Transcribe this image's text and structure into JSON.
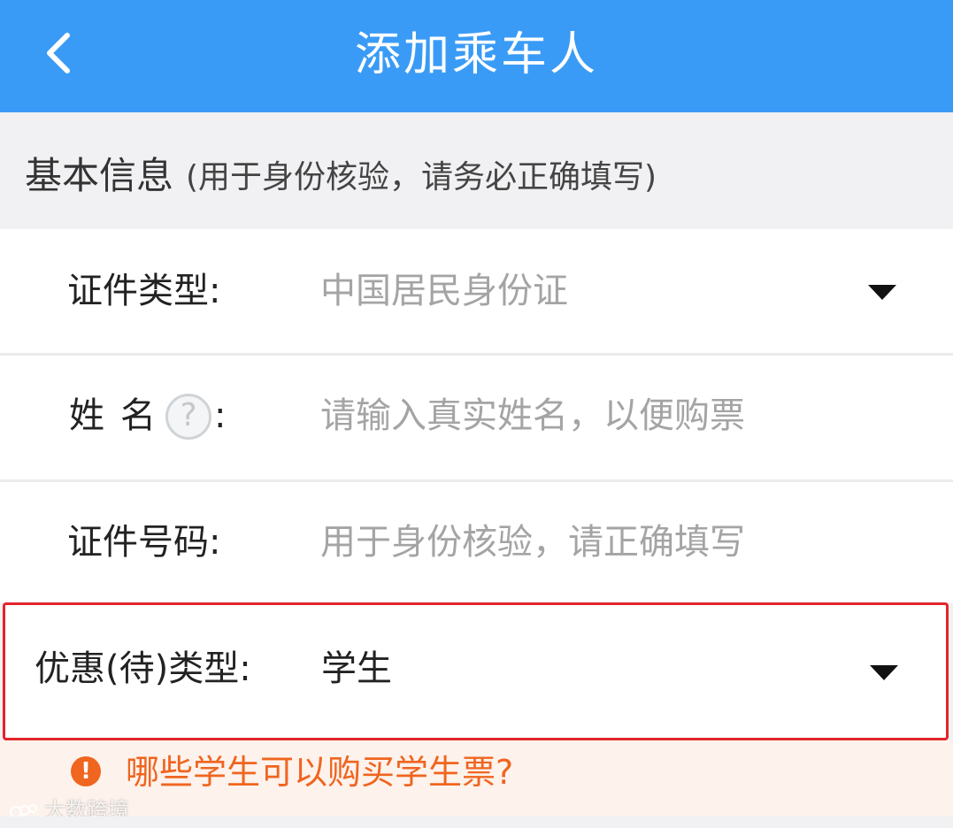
{
  "header": {
    "title": "添加乘车人",
    "back_icon": "chevron-left-icon",
    "background_color": "#3a9bf6"
  },
  "section": {
    "title": "基本信息",
    "subtitle": "(用于身份核验，请务必正确填写)"
  },
  "fields": {
    "id_type": {
      "label": "证件类型:",
      "value": "中国居民身份证",
      "icon": "caret-down-icon"
    },
    "name": {
      "label_part1": "姓",
      "label_part2": "名",
      "help_glyph": "?",
      "colon": ":",
      "placeholder": "请输入真实姓名，以便购票",
      "icon": "help-circle-icon"
    },
    "id_number": {
      "label": "证件号码:",
      "placeholder": "用于身份核验，请正确填写"
    },
    "discount_type": {
      "label": "优惠(待)类型:",
      "value": "学生",
      "icon": "caret-down-icon",
      "highlight_color": "#e3242b"
    }
  },
  "tip": {
    "icon_glyph": "!",
    "icon": "warning-circle-icon",
    "link_text": "哪些学生可以购买学生票?",
    "color": "#f0651f"
  },
  "watermark": {
    "text": "大数跨境"
  }
}
